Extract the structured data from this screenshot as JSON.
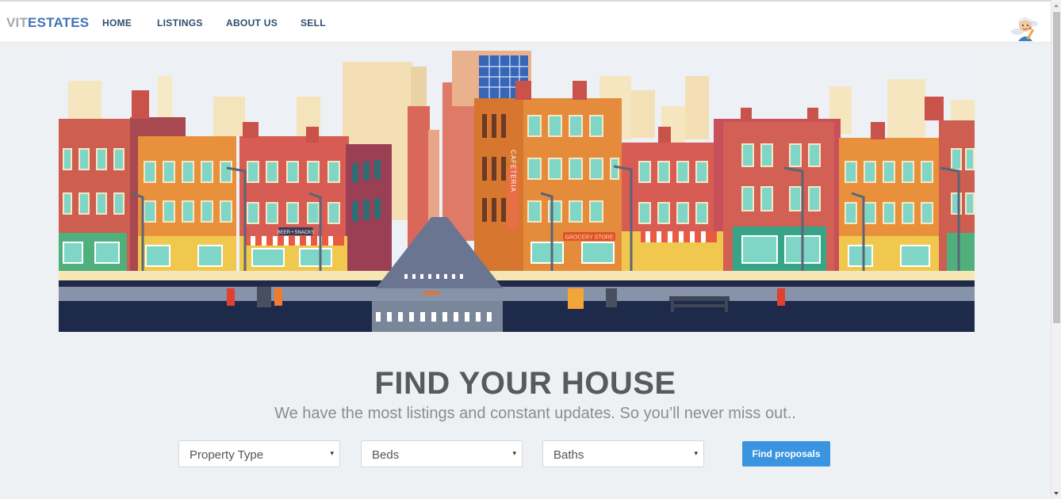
{
  "brand": {
    "part1": "VIT",
    "part2": "ESTATES"
  },
  "nav": {
    "home": "HOME",
    "listings": "LISTINGS",
    "about": "ABOUT US",
    "sell": "SELL"
  },
  "hero": {
    "signs": {
      "beer": "BEER • SNACKS",
      "cafeteria": "CAFETERIA",
      "grocery": "GROCERY STORE"
    }
  },
  "search": {
    "title": "FIND YOUR HOUSE",
    "subtitle": "We have the most listings and constant updates. So you’ll never miss out..",
    "property_type": "Property Type",
    "beds": "Beds",
    "baths": "Baths",
    "button": "Find proposals",
    "caret": "▾"
  },
  "colors": {
    "brand_gray": "#a3a9b2",
    "brand_blue": "#3f74b8",
    "button": "#3a94e0",
    "background": "#eef1f4"
  },
  "icons": {
    "avatar": "user-avatar-icon"
  }
}
